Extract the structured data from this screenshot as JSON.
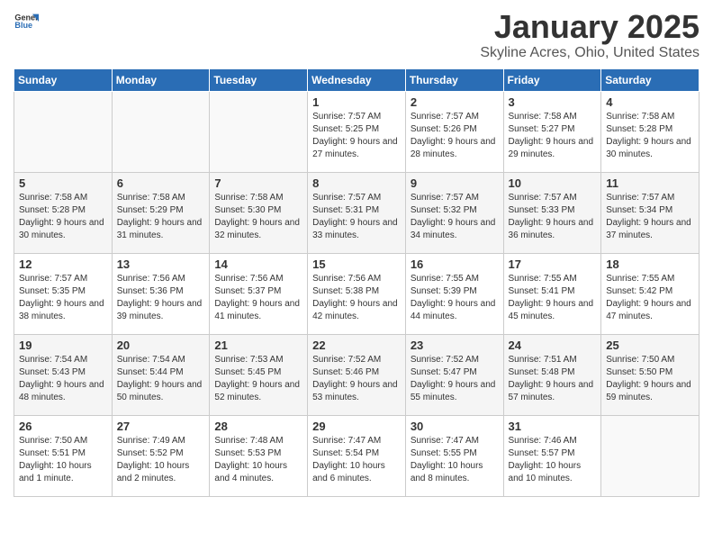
{
  "header": {
    "logo_general": "General",
    "logo_blue": "Blue",
    "month": "January 2025",
    "location": "Skyline Acres, Ohio, United States"
  },
  "weekdays": [
    "Sunday",
    "Monday",
    "Tuesday",
    "Wednesday",
    "Thursday",
    "Friday",
    "Saturday"
  ],
  "weeks": [
    [
      {
        "day": "",
        "info": ""
      },
      {
        "day": "",
        "info": ""
      },
      {
        "day": "",
        "info": ""
      },
      {
        "day": "1",
        "info": "Sunrise: 7:57 AM\nSunset: 5:25 PM\nDaylight: 9 hours and 27 minutes."
      },
      {
        "day": "2",
        "info": "Sunrise: 7:57 AM\nSunset: 5:26 PM\nDaylight: 9 hours and 28 minutes."
      },
      {
        "day": "3",
        "info": "Sunrise: 7:58 AM\nSunset: 5:27 PM\nDaylight: 9 hours and 29 minutes."
      },
      {
        "day": "4",
        "info": "Sunrise: 7:58 AM\nSunset: 5:28 PM\nDaylight: 9 hours and 30 minutes."
      }
    ],
    [
      {
        "day": "5",
        "info": "Sunrise: 7:58 AM\nSunset: 5:28 PM\nDaylight: 9 hours and 30 minutes."
      },
      {
        "day": "6",
        "info": "Sunrise: 7:58 AM\nSunset: 5:29 PM\nDaylight: 9 hours and 31 minutes."
      },
      {
        "day": "7",
        "info": "Sunrise: 7:58 AM\nSunset: 5:30 PM\nDaylight: 9 hours and 32 minutes."
      },
      {
        "day": "8",
        "info": "Sunrise: 7:57 AM\nSunset: 5:31 PM\nDaylight: 9 hours and 33 minutes."
      },
      {
        "day": "9",
        "info": "Sunrise: 7:57 AM\nSunset: 5:32 PM\nDaylight: 9 hours and 34 minutes."
      },
      {
        "day": "10",
        "info": "Sunrise: 7:57 AM\nSunset: 5:33 PM\nDaylight: 9 hours and 36 minutes."
      },
      {
        "day": "11",
        "info": "Sunrise: 7:57 AM\nSunset: 5:34 PM\nDaylight: 9 hours and 37 minutes."
      }
    ],
    [
      {
        "day": "12",
        "info": "Sunrise: 7:57 AM\nSunset: 5:35 PM\nDaylight: 9 hours and 38 minutes."
      },
      {
        "day": "13",
        "info": "Sunrise: 7:56 AM\nSunset: 5:36 PM\nDaylight: 9 hours and 39 minutes."
      },
      {
        "day": "14",
        "info": "Sunrise: 7:56 AM\nSunset: 5:37 PM\nDaylight: 9 hours and 41 minutes."
      },
      {
        "day": "15",
        "info": "Sunrise: 7:56 AM\nSunset: 5:38 PM\nDaylight: 9 hours and 42 minutes."
      },
      {
        "day": "16",
        "info": "Sunrise: 7:55 AM\nSunset: 5:39 PM\nDaylight: 9 hours and 44 minutes."
      },
      {
        "day": "17",
        "info": "Sunrise: 7:55 AM\nSunset: 5:41 PM\nDaylight: 9 hours and 45 minutes."
      },
      {
        "day": "18",
        "info": "Sunrise: 7:55 AM\nSunset: 5:42 PM\nDaylight: 9 hours and 47 minutes."
      }
    ],
    [
      {
        "day": "19",
        "info": "Sunrise: 7:54 AM\nSunset: 5:43 PM\nDaylight: 9 hours and 48 minutes."
      },
      {
        "day": "20",
        "info": "Sunrise: 7:54 AM\nSunset: 5:44 PM\nDaylight: 9 hours and 50 minutes."
      },
      {
        "day": "21",
        "info": "Sunrise: 7:53 AM\nSunset: 5:45 PM\nDaylight: 9 hours and 52 minutes."
      },
      {
        "day": "22",
        "info": "Sunrise: 7:52 AM\nSunset: 5:46 PM\nDaylight: 9 hours and 53 minutes."
      },
      {
        "day": "23",
        "info": "Sunrise: 7:52 AM\nSunset: 5:47 PM\nDaylight: 9 hours and 55 minutes."
      },
      {
        "day": "24",
        "info": "Sunrise: 7:51 AM\nSunset: 5:48 PM\nDaylight: 9 hours and 57 minutes."
      },
      {
        "day": "25",
        "info": "Sunrise: 7:50 AM\nSunset: 5:50 PM\nDaylight: 9 hours and 59 minutes."
      }
    ],
    [
      {
        "day": "26",
        "info": "Sunrise: 7:50 AM\nSunset: 5:51 PM\nDaylight: 10 hours and 1 minute."
      },
      {
        "day": "27",
        "info": "Sunrise: 7:49 AM\nSunset: 5:52 PM\nDaylight: 10 hours and 2 minutes."
      },
      {
        "day": "28",
        "info": "Sunrise: 7:48 AM\nSunset: 5:53 PM\nDaylight: 10 hours and 4 minutes."
      },
      {
        "day": "29",
        "info": "Sunrise: 7:47 AM\nSunset: 5:54 PM\nDaylight: 10 hours and 6 minutes."
      },
      {
        "day": "30",
        "info": "Sunrise: 7:47 AM\nSunset: 5:55 PM\nDaylight: 10 hours and 8 minutes."
      },
      {
        "day": "31",
        "info": "Sunrise: 7:46 AM\nSunset: 5:57 PM\nDaylight: 10 hours and 10 minutes."
      },
      {
        "day": "",
        "info": ""
      }
    ]
  ]
}
